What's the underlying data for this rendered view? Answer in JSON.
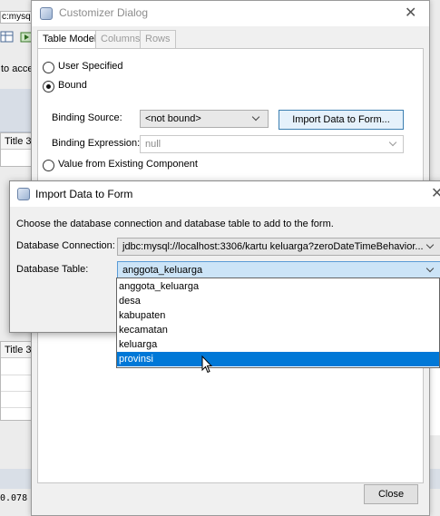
{
  "background": {
    "connection_fragment": "c:mysq",
    "access_fragment": "to acce",
    "table_header_upper": "Title 3",
    "table_header_lower": "Title 3",
    "coord_fragment": "0.078"
  },
  "customizer": {
    "title": "Customizer Dialog",
    "tabs": [
      "Table Model",
      "Columns",
      "Rows"
    ],
    "radio_user_specified": "User Specified",
    "radio_bound": "Bound",
    "binding_source_label": "Binding Source:",
    "binding_source_value": "<not bound>",
    "import_button": "Import Data to Form...",
    "binding_expression_label": "Binding Expression:",
    "binding_expression_value": "null",
    "radio_existing": "Value from Existing Component",
    "close_button": "Close"
  },
  "import_dialog": {
    "title": "Import Data to Form",
    "instructions": "Choose the database connection and database table to add to the form.",
    "connection_label": "Database Connection:",
    "connection_value": "jdbc:mysql://localhost:3306/kartu keluarga?zeroDateTimeBehavior...",
    "table_label": "Database Table:",
    "table_value": "anggota_keluarga",
    "table_options": [
      "anggota_keluarga",
      "desa",
      "kabupaten",
      "kecamatan",
      "keluarga",
      "provinsi"
    ],
    "highlighted_option": "provinsi"
  },
  "colors": {
    "selection": "#0078d7",
    "focus_border": "#3c7fb1",
    "combo_selected_bg": "#cce4f7"
  }
}
